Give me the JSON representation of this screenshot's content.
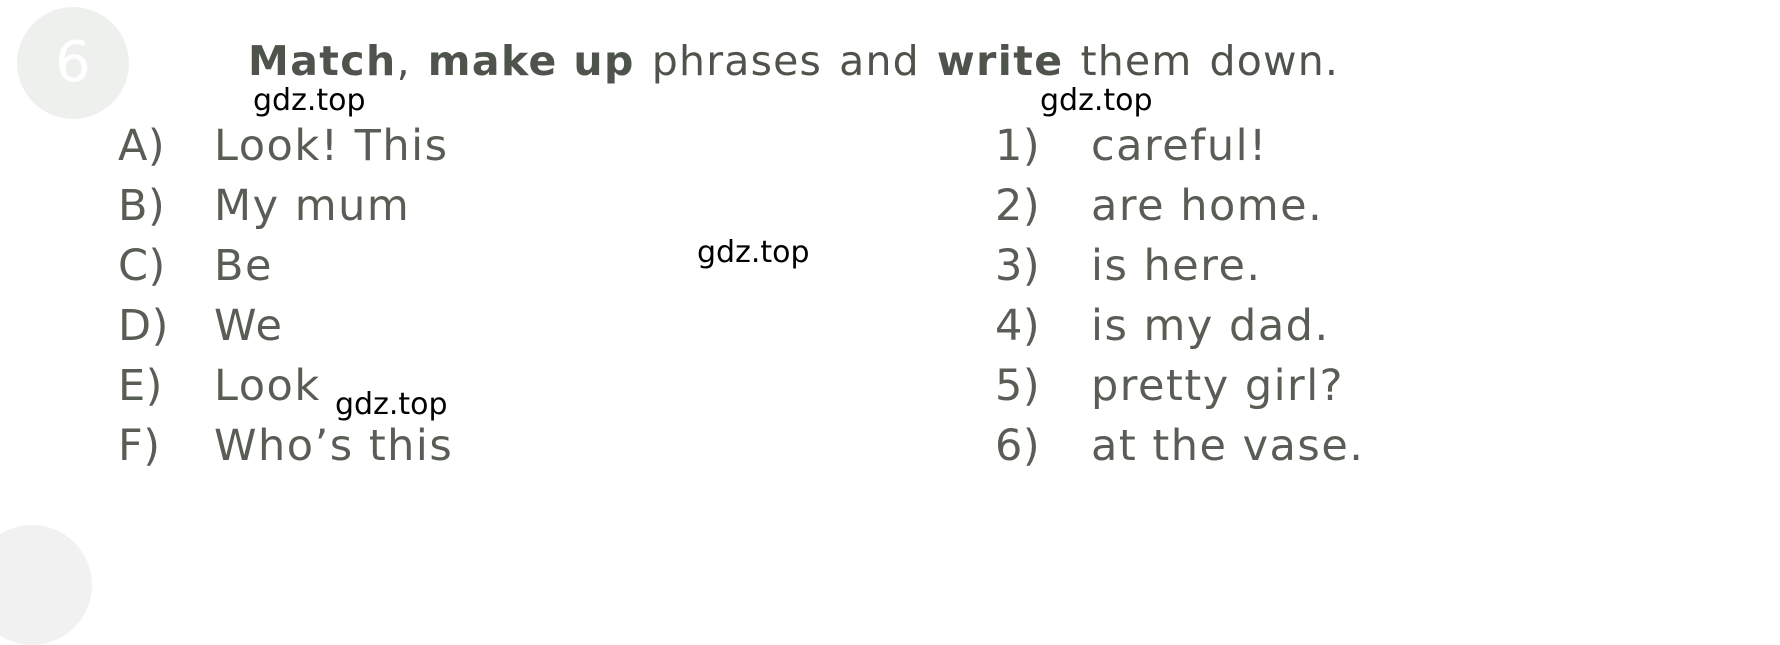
{
  "page": {
    "background_color": "#ffffff",
    "text_color": "#585e55"
  },
  "exercise": {
    "number": "6",
    "badge_color": "#eceeec",
    "number_color": "#ffffff"
  },
  "instruction": {
    "segments": [
      {
        "text": "Match",
        "bold": true
      },
      {
        "text": ",",
        "bold": false
      },
      {
        "text": "make up",
        "bold": true
      },
      {
        "text": "phrases",
        "bold": false
      },
      {
        "text": "and",
        "bold": false
      },
      {
        "text": "write",
        "bold": true
      },
      {
        "text": "them",
        "bold": false
      },
      {
        "text": "down.",
        "bold": false
      }
    ],
    "full_text": "Match, make up phrases and write them down.",
    "part_1_bold": "Match",
    "part_2_comma": ",",
    "part_3_bold": "make up",
    "part_4_plain": "phrases",
    "part_5_plain": "and",
    "part_6_bold": "write",
    "part_7_plain": "them",
    "part_8_plain": "down."
  },
  "left_column": {
    "items": [
      {
        "marker": "A)",
        "text": "Look!  This"
      },
      {
        "marker": "B)",
        "text": "My  mum"
      },
      {
        "marker": "C)",
        "text": "Be"
      },
      {
        "marker": "D)",
        "text": "We"
      },
      {
        "marker": "E)",
        "text": "Look"
      },
      {
        "marker": "F)",
        "text": "Who’s  this"
      }
    ]
  },
  "right_column": {
    "items": [
      {
        "marker": "1)",
        "text": "careful!"
      },
      {
        "marker": "2)",
        "text": "are  home."
      },
      {
        "marker": "3)",
        "text": "is  here."
      },
      {
        "marker": "4)",
        "text": "is  my  dad."
      },
      {
        "marker": "5)",
        "text": "pretty  girl?"
      },
      {
        "marker": "6)",
        "text": "at  the  vase."
      }
    ]
  },
  "watermarks": {
    "text": "gdz.top",
    "items": [
      {
        "text": "gdz.top"
      },
      {
        "text": "gdz.top"
      },
      {
        "text": "gdz.top"
      },
      {
        "text": "gdz.top"
      }
    ]
  }
}
